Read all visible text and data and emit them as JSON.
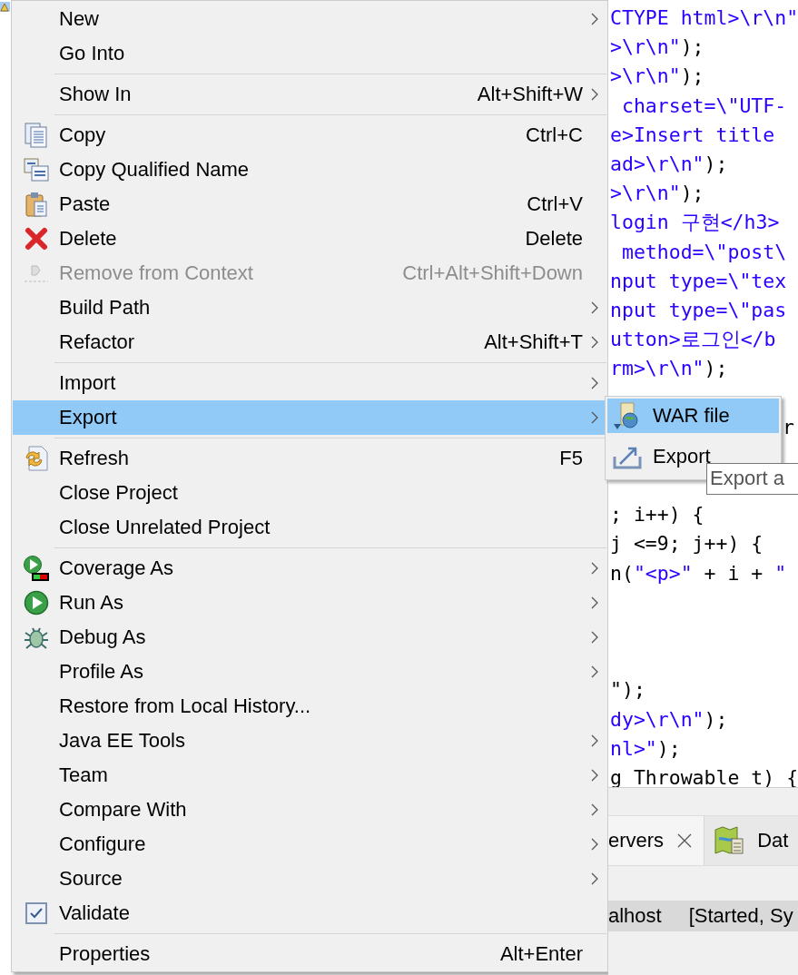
{
  "context_menu": {
    "groups": [
      [
        {
          "label": "New",
          "kind": "plain",
          "submenu": true,
          "selected": false,
          "disabled": false
        },
        {
          "label": "Go Into",
          "kind": "plain",
          "submenu": false,
          "selected": false,
          "disabled": false
        }
      ],
      [
        {
          "label": "Show In",
          "shortcut": "Alt+Shift+W",
          "kind": "plain",
          "submenu": true,
          "selected": false,
          "disabled": false
        }
      ],
      [
        {
          "label": "Copy",
          "shortcut": "Ctrl+C",
          "kind": "copy",
          "submenu": false,
          "selected": false,
          "disabled": false
        },
        {
          "label": "Copy Qualified Name",
          "kind": "copy-qualified",
          "submenu": false,
          "selected": false,
          "disabled": false
        },
        {
          "label": "Paste",
          "shortcut": "Ctrl+V",
          "kind": "paste",
          "submenu": false,
          "selected": false,
          "disabled": false
        },
        {
          "label": "Delete",
          "shortcut": "Delete",
          "kind": "delete",
          "submenu": false,
          "selected": false,
          "disabled": false
        },
        {
          "label": "Remove from Context",
          "shortcut": "Ctrl+Alt+Shift+Down",
          "kind": "remove",
          "submenu": false,
          "selected": false,
          "disabled": true
        },
        {
          "label": "Build Path",
          "kind": "plain",
          "submenu": true,
          "selected": false,
          "disabled": false
        },
        {
          "label": "Refactor",
          "shortcut": "Alt+Shift+T",
          "kind": "plain",
          "submenu": true,
          "selected": false,
          "disabled": false
        }
      ],
      [
        {
          "label": "Import",
          "kind": "plain",
          "submenu": true,
          "selected": false,
          "disabled": false
        },
        {
          "label": "Export",
          "kind": "plain",
          "submenu": true,
          "selected": true,
          "disabled": false
        }
      ],
      [
        {
          "label": "Refresh",
          "shortcut": "F5",
          "kind": "refresh",
          "submenu": false,
          "selected": false,
          "disabled": false
        },
        {
          "label": "Close Project",
          "kind": "plain",
          "submenu": false,
          "selected": false,
          "disabled": false
        },
        {
          "label": "Close Unrelated Project",
          "kind": "plain",
          "submenu": false,
          "selected": false,
          "disabled": false
        }
      ],
      [
        {
          "label": "Coverage As",
          "kind": "coverage",
          "submenu": true,
          "selected": false,
          "disabled": false
        },
        {
          "label": "Run As",
          "kind": "run",
          "submenu": true,
          "selected": false,
          "disabled": false
        },
        {
          "label": "Debug As",
          "kind": "debug",
          "submenu": true,
          "selected": false,
          "disabled": false
        },
        {
          "label": "Profile As",
          "kind": "plain",
          "submenu": true,
          "selected": false,
          "disabled": false
        },
        {
          "label": "Restore from Local History...",
          "kind": "plain",
          "submenu": false,
          "selected": false,
          "disabled": false
        },
        {
          "label": "Java EE Tools",
          "kind": "plain",
          "submenu": true,
          "selected": false,
          "disabled": false
        },
        {
          "label": "Team",
          "kind": "plain",
          "submenu": true,
          "selected": false,
          "disabled": false
        },
        {
          "label": "Compare With",
          "kind": "plain",
          "submenu": true,
          "selected": false,
          "disabled": false
        },
        {
          "label": "Configure",
          "kind": "plain",
          "submenu": true,
          "selected": false,
          "disabled": false
        },
        {
          "label": "Source",
          "kind": "plain",
          "submenu": true,
          "selected": false,
          "disabled": false
        },
        {
          "label": "Validate",
          "kind": "check",
          "checked": true,
          "submenu": false,
          "selected": false,
          "disabled": false
        }
      ],
      [
        {
          "label": "Properties",
          "shortcut": "Alt+Enter",
          "kind": "plain",
          "submenu": false,
          "selected": false,
          "disabled": false
        }
      ]
    ]
  },
  "submenu": {
    "items": [
      {
        "label": "WAR file",
        "kind": "war",
        "selected": true
      },
      {
        "label": "Export",
        "kind": "export",
        "selected": false
      }
    ]
  },
  "tooltip": {
    "text": "Export a"
  },
  "editor": {
    "lines": [
      {
        "kind": "code",
        "segments": [
          {
            "kind": "string",
            "text": "CTYPE html>\\r\\n\""
          }
        ]
      },
      {
        "kind": "code",
        "segments": [
          {
            "kind": "string",
            "text": ">\\r\\n\""
          },
          {
            "kind": "plain",
            "text": ");"
          }
        ]
      },
      {
        "kind": "code",
        "segments": [
          {
            "kind": "string",
            "text": ">\\r\\n\""
          },
          {
            "kind": "plain",
            "text": ");"
          }
        ]
      },
      {
        "kind": "code",
        "segments": [
          {
            "kind": "string",
            "text": " charset=\\\"UTF-"
          }
        ]
      },
      {
        "kind": "code",
        "segments": [
          {
            "kind": "string",
            "text": "e>Insert title"
          }
        ]
      },
      {
        "kind": "code",
        "segments": [
          {
            "kind": "string",
            "text": "ad>\\r\\n\""
          },
          {
            "kind": "plain",
            "text": ");"
          }
        ]
      },
      {
        "kind": "code",
        "segments": [
          {
            "kind": "string",
            "text": ">\\r\\n\""
          },
          {
            "kind": "plain",
            "text": ");"
          }
        ]
      },
      {
        "kind": "code",
        "segments": [
          {
            "kind": "string",
            "text": "login 구현</h3>"
          }
        ]
      },
      {
        "kind": "code",
        "segments": [
          {
            "kind": "string",
            "text": " method=\\\"post\\"
          }
        ]
      },
      {
        "kind": "code",
        "segments": [
          {
            "kind": "string",
            "text": "nput type=\\\"tex"
          }
        ]
      },
      {
        "kind": "code",
        "segments": [
          {
            "kind": "string",
            "text": "nput type=\\\"pas"
          }
        ]
      },
      {
        "kind": "code",
        "segments": [
          {
            "kind": "string",
            "text": "utton>로그인</b"
          }
        ]
      },
      {
        "kind": "code",
        "segments": [
          {
            "kind": "string",
            "text": "rm>\\r\\n\""
          },
          {
            "kind": "plain",
            "text": ");"
          }
        ]
      },
      {
        "kind": "blank"
      },
      {
        "kind": "overlapped",
        "segments": [
          {
            "kind": "plain",
            "text": "r"
          }
        ]
      },
      {
        "kind": "blank"
      },
      {
        "kind": "blank"
      },
      {
        "kind": "code",
        "segments": [
          {
            "kind": "plain",
            "text": "; i++) {"
          }
        ]
      },
      {
        "kind": "code",
        "segments": [
          {
            "kind": "plain",
            "text": "j <=9; j++) {"
          }
        ]
      },
      {
        "kind": "code",
        "segments": [
          {
            "kind": "plain",
            "text": "n("
          },
          {
            "kind": "string",
            "text": "\"<p>\""
          },
          {
            "kind": "plain",
            "text": " + i + "
          },
          {
            "kind": "string",
            "text": "\""
          }
        ]
      },
      {
        "kind": "blank"
      },
      {
        "kind": "blank"
      },
      {
        "kind": "blank"
      },
      {
        "kind": "code",
        "segments": [
          {
            "kind": "plain",
            "text": "\");"
          }
        ]
      },
      {
        "kind": "code",
        "segments": [
          {
            "kind": "string",
            "text": "dy>\\r\\n\""
          },
          {
            "kind": "plain",
            "text": ");"
          }
        ]
      },
      {
        "kind": "code",
        "segments": [
          {
            "kind": "string",
            "text": "nl>\""
          },
          {
            "kind": "plain",
            "text": ");"
          }
        ]
      },
      {
        "kind": "code",
        "segments": [
          {
            "kind": "plain",
            "text": "g Throwable t) {"
          }
        ]
      }
    ]
  },
  "bottom_panel": {
    "tabs": [
      {
        "label": "ervers",
        "selected": true,
        "closable": true,
        "kind": "servers"
      },
      {
        "label": "Dat",
        "selected": false,
        "closable": false,
        "kind": "data"
      }
    ],
    "rows": [
      {
        "name": "alhost",
        "status": "[Started, Sy",
        "selected": true
      }
    ]
  }
}
